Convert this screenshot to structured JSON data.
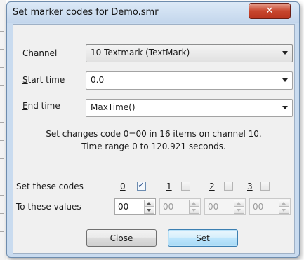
{
  "window": {
    "title": "Set marker codes for Demo.smr",
    "close_glyph": "✕"
  },
  "channel": {
    "label_prefix": "C",
    "label_rest": "hannel",
    "value": "10 Textmark (TextMark)"
  },
  "start_time": {
    "label_prefix": "S",
    "label_rest": "tart time",
    "value": "0.0"
  },
  "end_time": {
    "label_prefix": "E",
    "label_rest": "nd time",
    "value": "MaxTime()"
  },
  "info": {
    "line1": "Set changes code 0=00 in 16 items on channel 10.",
    "line2": "Time range 0 to 120.921 seconds."
  },
  "codes": {
    "label": "Set these codes",
    "items": [
      {
        "label": "0",
        "checked": true
      },
      {
        "label": "1",
        "checked": false
      },
      {
        "label": "2",
        "checked": false
      },
      {
        "label": "3",
        "checked": false
      }
    ],
    "check_glyph": "✓"
  },
  "values": {
    "label": "To these values",
    "items": [
      {
        "value": "00",
        "enabled": true
      },
      {
        "value": "00",
        "enabled": false
      },
      {
        "value": "00",
        "enabled": false
      },
      {
        "value": "00",
        "enabled": false
      }
    ]
  },
  "buttons": {
    "close": "Close",
    "set": "Set"
  }
}
